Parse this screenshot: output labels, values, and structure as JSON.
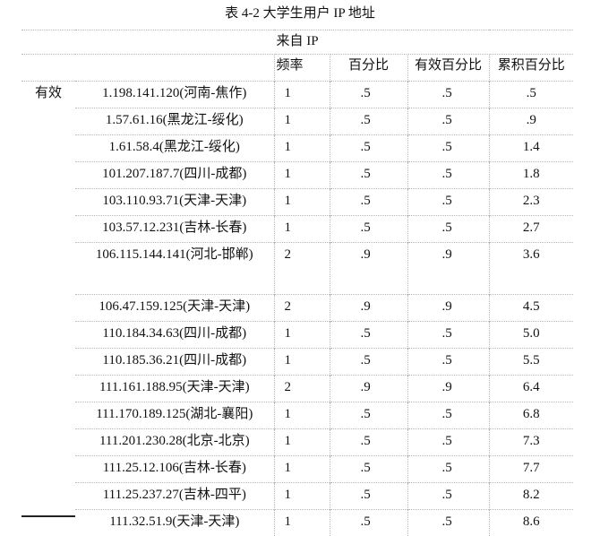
{
  "caption": "表 4-2  大学生用户 IP 地址",
  "super_header": "来自 IP",
  "columns": {
    "frequency": "频率",
    "percent": "百分比",
    "valid_percent": "有效百分比",
    "cumulative_percent": "累积百分比"
  },
  "group_label": "有效",
  "rows": [
    {
      "ip": "1.198.141.120(河南-焦作)",
      "frequency": "1",
      "percent": ".5",
      "valid_percent": ".5",
      "cumulative_percent": ".5"
    },
    {
      "ip": "1.57.61.16(黑龙江-绥化)",
      "frequency": "1",
      "percent": ".5",
      "valid_percent": ".5",
      "cumulative_percent": ".9"
    },
    {
      "ip": "1.61.58.4(黑龙江-绥化)",
      "frequency": "1",
      "percent": ".5",
      "valid_percent": ".5",
      "cumulative_percent": "1.4"
    },
    {
      "ip": "101.207.187.7(四川-成都)",
      "frequency": "1",
      "percent": ".5",
      "valid_percent": ".5",
      "cumulative_percent": "1.8"
    },
    {
      "ip": "103.110.93.71(天津-天津)",
      "frequency": "1",
      "percent": ".5",
      "valid_percent": ".5",
      "cumulative_percent": "2.3"
    },
    {
      "ip": "103.57.12.231(吉林-长春)",
      "frequency": "1",
      "percent": ".5",
      "valid_percent": ".5",
      "cumulative_percent": "2.7"
    },
    {
      "ip": "106.115.144.141(河北-邯郸)",
      "frequency": "2",
      "percent": ".9",
      "valid_percent": ".9",
      "cumulative_percent": "3.6"
    },
    {
      "ip": "106.47.159.125(天津-天津)",
      "frequency": "2",
      "percent": ".9",
      "valid_percent": ".9",
      "cumulative_percent": "4.5"
    },
    {
      "ip": "110.184.34.63(四川-成都)",
      "frequency": "1",
      "percent": ".5",
      "valid_percent": ".5",
      "cumulative_percent": "5.0"
    },
    {
      "ip": "110.185.36.21(四川-成都)",
      "frequency": "1",
      "percent": ".5",
      "valid_percent": ".5",
      "cumulative_percent": "5.5"
    },
    {
      "ip": "111.161.188.95(天津-天津)",
      "frequency": "2",
      "percent": ".9",
      "valid_percent": ".9",
      "cumulative_percent": "6.4"
    },
    {
      "ip": "111.170.189.125(湖北-襄阳)",
      "frequency": "1",
      "percent": ".5",
      "valid_percent": ".5",
      "cumulative_percent": "6.8"
    },
    {
      "ip": "111.201.230.28(北京-北京)",
      "frequency": "1",
      "percent": ".5",
      "valid_percent": ".5",
      "cumulative_percent": "7.3"
    },
    {
      "ip": "111.25.12.106(吉林-长春)",
      "frequency": "1",
      "percent": ".5",
      "valid_percent": ".5",
      "cumulative_percent": "7.7"
    },
    {
      "ip": "111.25.237.27(吉林-四平)",
      "frequency": "1",
      "percent": ".5",
      "valid_percent": ".5",
      "cumulative_percent": "8.2"
    },
    {
      "ip": "111.32.51.9(天津-天津)",
      "frequency": "1",
      "percent": ".5",
      "valid_percent": ".5",
      "cumulative_percent": "8.6"
    }
  ]
}
